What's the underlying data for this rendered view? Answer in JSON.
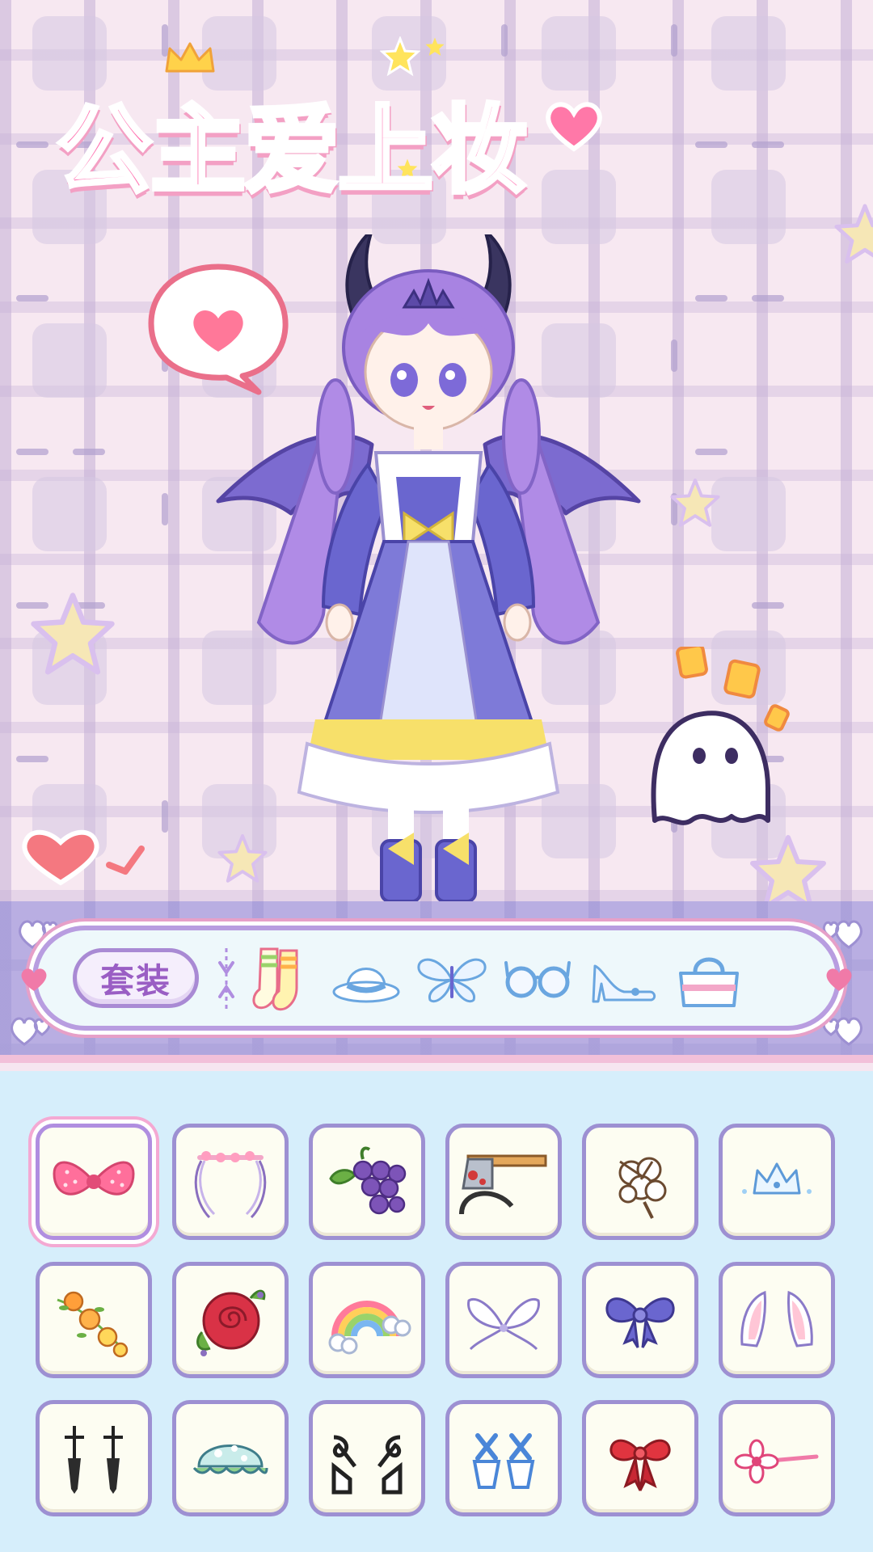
{
  "title": "公主爱上妆",
  "category_bar": {
    "outfit_label": "套装",
    "categories": [
      {
        "name": "socks",
        "icon": "socks-icon"
      },
      {
        "name": "hat",
        "icon": "hat-icon"
      },
      {
        "name": "wings",
        "icon": "butterfly-icon"
      },
      {
        "name": "glasses",
        "icon": "glasses-icon"
      },
      {
        "name": "shoes",
        "icon": "high-heel-icon"
      },
      {
        "name": "bag",
        "icon": "handbag-icon"
      }
    ]
  },
  "items_panel": {
    "selected_index": 0,
    "items": [
      {
        "name": "pink-bow",
        "icon": "pink-bow-icon"
      },
      {
        "name": "flower-ribbon-headband",
        "icon": "flower-headband-icon"
      },
      {
        "name": "grape-clip",
        "icon": "grapes-icon"
      },
      {
        "name": "cleaver-headband",
        "icon": "cleaver-icon"
      },
      {
        "name": "cotton-clip",
        "icon": "cotton-icon"
      },
      {
        "name": "tiara",
        "icon": "tiara-icon"
      },
      {
        "name": "flower-vine",
        "icon": "orange-flowers-icon"
      },
      {
        "name": "red-rose",
        "icon": "rose-icon"
      },
      {
        "name": "rainbow-clip",
        "icon": "rainbow-icon"
      },
      {
        "name": "white-ribbon-bow",
        "icon": "white-bow-icon"
      },
      {
        "name": "blue-bow",
        "icon": "blue-bow-icon"
      },
      {
        "name": "bunny-ears",
        "icon": "rabbit-ears-icon"
      },
      {
        "name": "black-pins",
        "icon": "black-pins-icon"
      },
      {
        "name": "mint-bonnet",
        "icon": "bonnet-icon"
      },
      {
        "name": "black-ribbon-clips",
        "icon": "black-ribbon-icon"
      },
      {
        "name": "blue-cross-clips",
        "icon": "blue-clips-icon"
      },
      {
        "name": "red-bow",
        "icon": "red-bow-icon"
      },
      {
        "name": "flower-hairpin",
        "icon": "flower-pin-icon"
      }
    ]
  },
  "colors": {
    "accent_pink": "#ff74b2",
    "frame_purple": "#9d90d2",
    "panel_blue": "#d6eefb"
  }
}
